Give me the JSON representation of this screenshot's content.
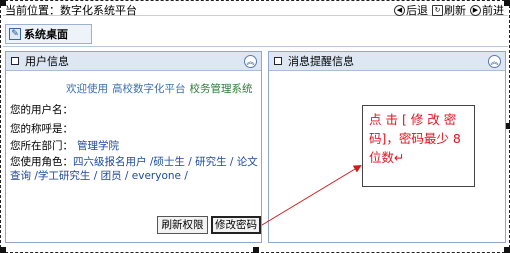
{
  "topbar": {
    "location": "当前位置：数字化系统平台",
    "nav": [
      {
        "icon": "back-icon",
        "glyph": "◀",
        "label": "后退"
      },
      {
        "icon": "refresh-icon",
        "glyph": "↻",
        "label": "刷新"
      },
      {
        "icon": "forward-icon",
        "glyph": "▶",
        "label": "前进"
      }
    ]
  },
  "desktop_tab": {
    "label": "系统桌面"
  },
  "user_panel": {
    "title": "用户信息",
    "welcome": [
      "欢迎使用",
      "高校数字化平台",
      "校务管理系统"
    ],
    "rows": [
      {
        "label": "您的用户名：",
        "value": ""
      },
      {
        "label": "您的称呼是：",
        "value": ""
      },
      {
        "label": "您所在部门：",
        "value": "管理学院"
      }
    ],
    "roles_label": "您使用角色：",
    "roles_value": "四六级报名用户 /硕士生 / 研究生 / 论文查询 /学工研究生 / 团员 / everyone /",
    "btn_refresh": "刷新权限",
    "btn_change": "修改密码"
  },
  "message_panel": {
    "title": "消息提醒信息"
  },
  "callout": {
    "text": "点 击 [ 修 改 密 码]，密码最少 8 位数↵"
  },
  "colors": {
    "callout_text": "#e0141e",
    "arrow": "#d41818",
    "panel_header": "#dde7f4"
  }
}
